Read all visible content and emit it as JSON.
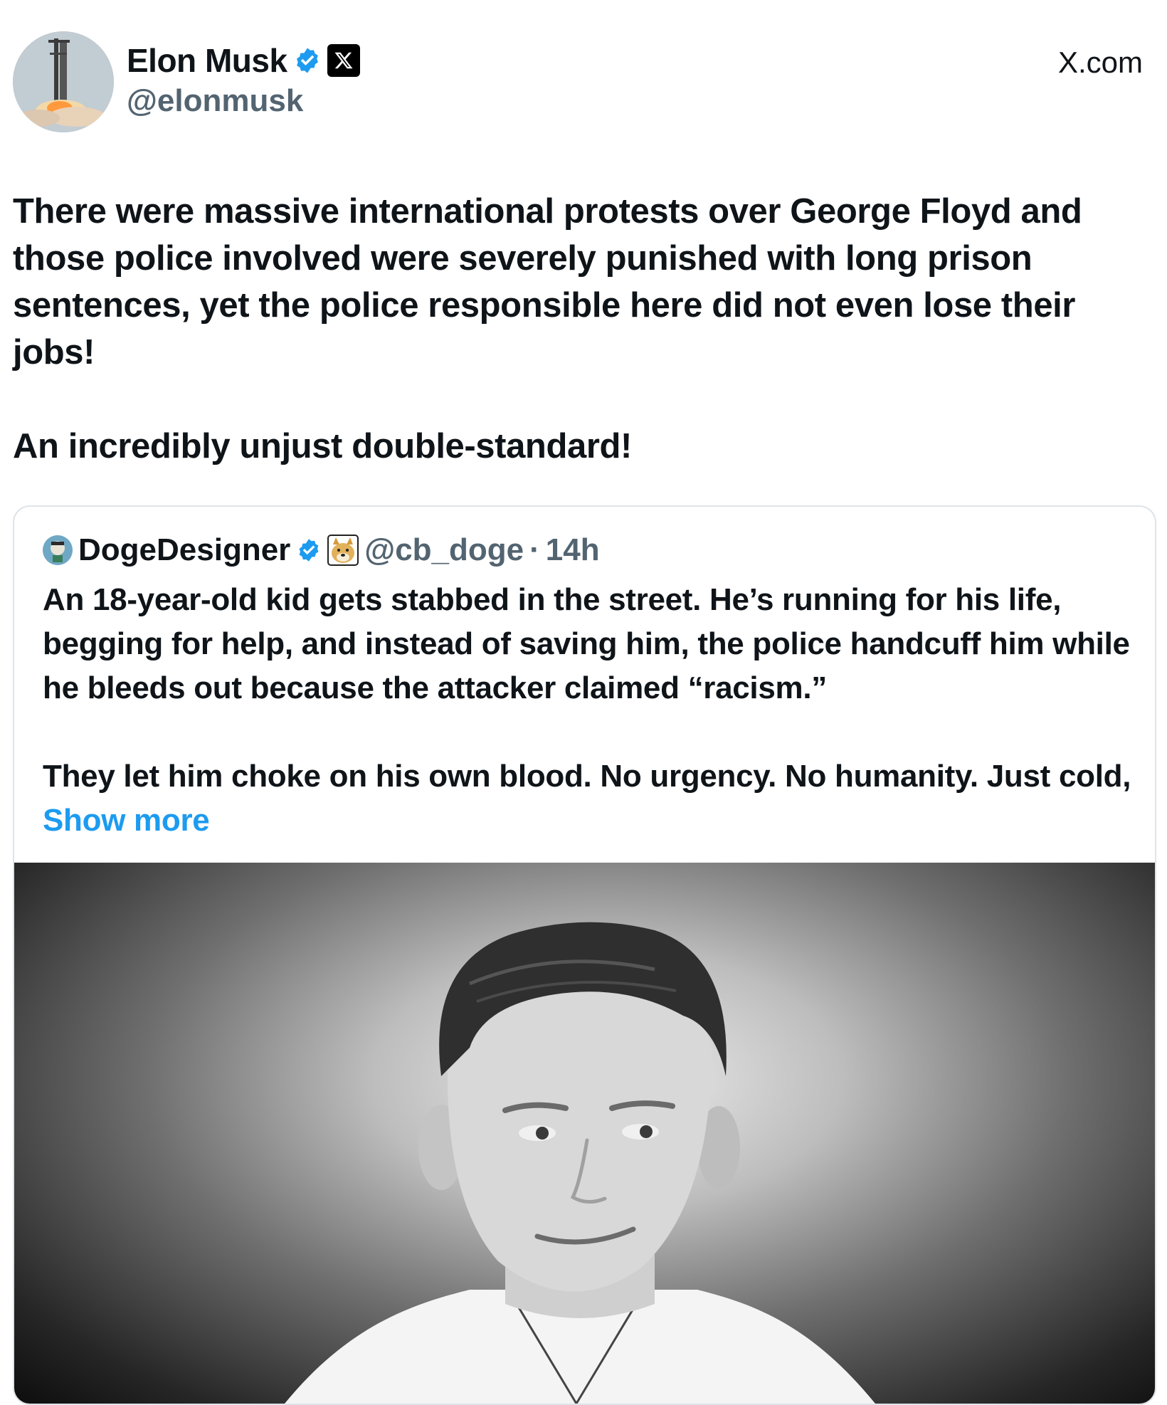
{
  "author": {
    "display_name": "Elon Musk",
    "handle": "@elonmusk",
    "avatar_icon": "rocket-launch-avatar",
    "verified_icon": "verified-badge-icon",
    "affiliation_icon": "x-logo-icon"
  },
  "brand_link": "X.com",
  "post": {
    "paragraphs": [
      "There were massive international protests over George Floyd and those police involved were severely punished with long prison sentences, yet the police responsible here did not even lose their jobs!",
      "An incredibly unjust double-standard!"
    ]
  },
  "quoted": {
    "display_name": "DogeDesigner",
    "handle": "@cb_doge",
    "separator": "·",
    "time": "14h",
    "paragraph_1": "An 18-year-old kid gets stabbed in the street. He’s running for his life, begging for help, and instead of saving him, the police handcuff him while he bleeds out because the attacker claimed “racism.”",
    "paragraph_2": "They let him choke on his own blood. No urgency. No humanity. Just cold,",
    "show_more": "Show more",
    "media_icon": "portrait-photo"
  },
  "colors": {
    "accent": "#1d9bf0",
    "text": "#0f1419",
    "secondary": "#536471",
    "border": "#dfe4e8"
  }
}
